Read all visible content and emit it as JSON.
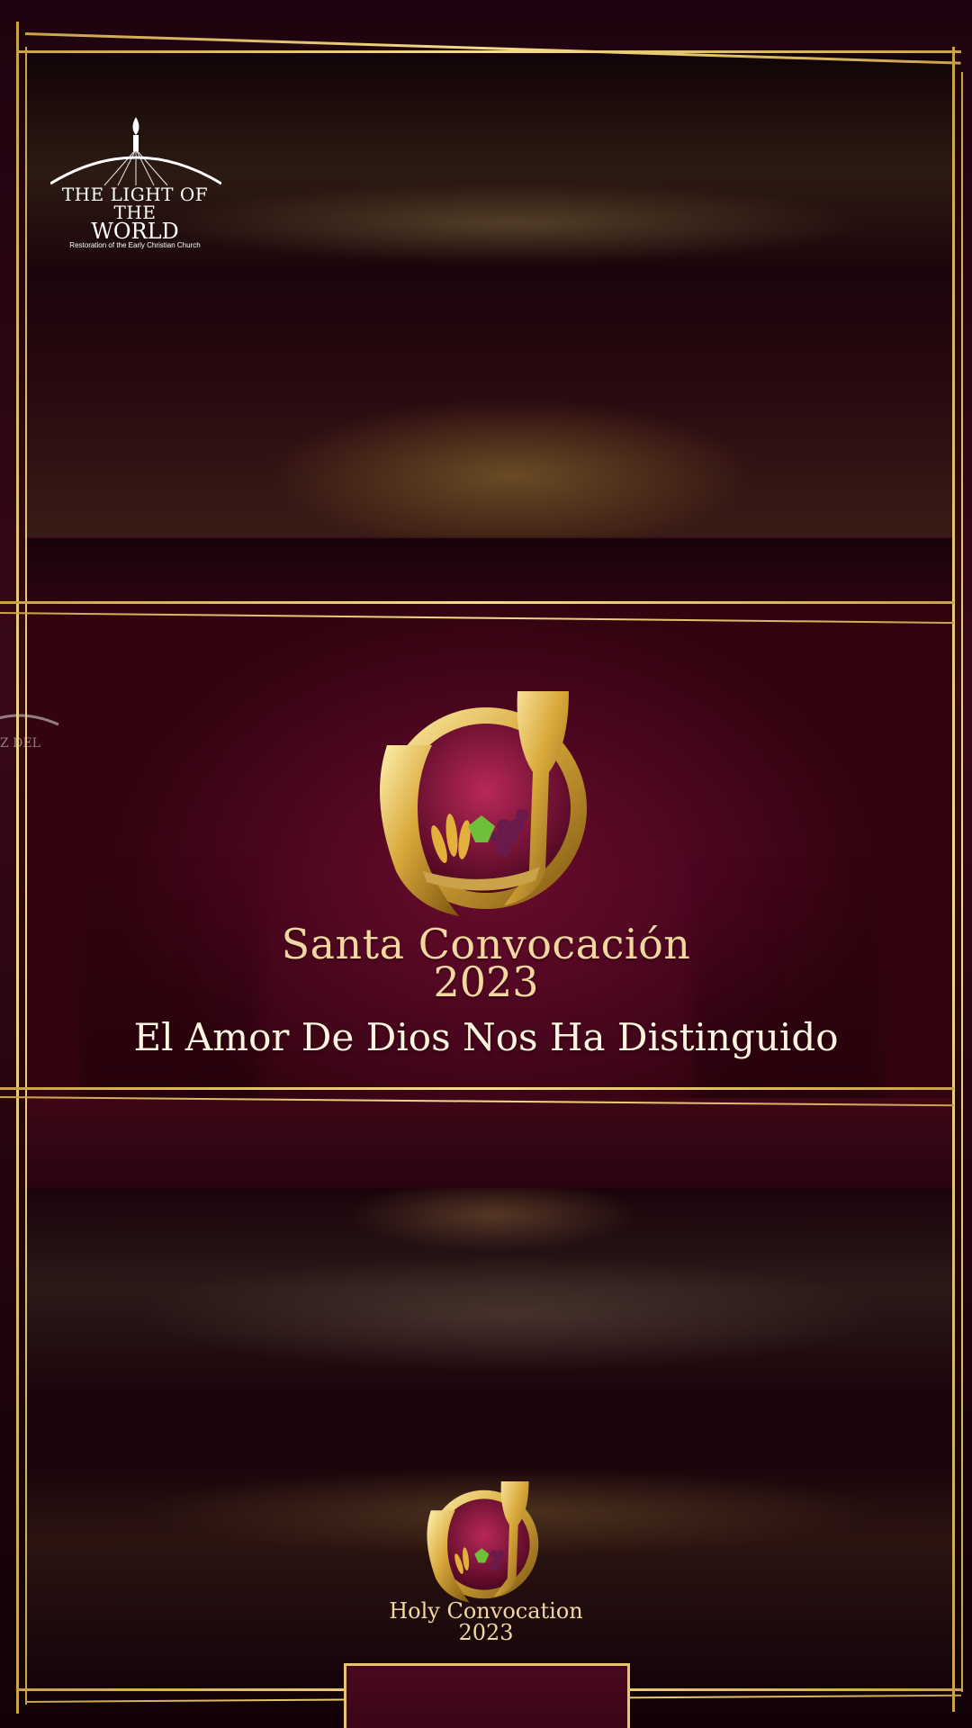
{
  "header_logo": {
    "brand_line1": "THE LIGHT OF THE",
    "brand_line2": "WORLD",
    "subtitle": "Restoration of the Early Christian Church",
    "icon": "torch-arch-icon"
  },
  "event": {
    "title_es": "Santa Convocación",
    "year_es": "2023",
    "tagline": "El Amor De Dios Nos Ha Distinguido",
    "title_en": "Holy Convocation",
    "year_en": "2023",
    "emblem_icon": "chalice-wheat-grapes-emblem-icon"
  },
  "colors": {
    "maroon": "#4c0620",
    "dark_maroon": "#1e0410",
    "gold": "#e7c56e",
    "cream_text": "#f2d7a0"
  }
}
